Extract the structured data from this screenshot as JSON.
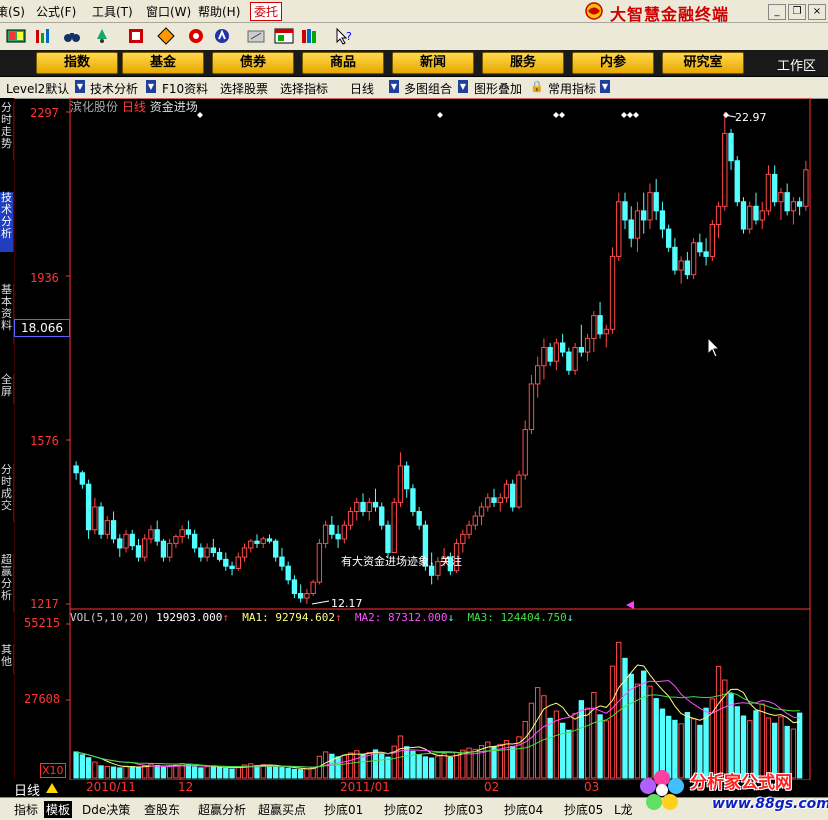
{
  "menu": {
    "items": [
      "策(S)",
      "公式(F)",
      "工具(T)",
      "窗口(W)",
      "帮助(H)"
    ],
    "weituo": "委托",
    "brand": "大智慧金融终端"
  },
  "toolbar": {
    "icons": [
      "grid-icon",
      "bars-icon",
      "binoculars-icon",
      "alarm-icon",
      "bookmark-icon",
      "diamond-icon",
      "radar-icon",
      "hand-icon",
      "pen-icon",
      "window-icon",
      "books-icon",
      "help-pointer-icon"
    ]
  },
  "nav": {
    "buttons": [
      "指数",
      "基金",
      "债券",
      "商品",
      "新闻",
      "服务",
      "内参",
      "研究室"
    ],
    "workspace": "工作区"
  },
  "funcbar": {
    "items": [
      "Level2默认",
      "技术分析",
      "F10资料",
      "选择股票",
      "选择指标",
      "日线",
      "多图组合",
      "图形叠加",
      "常用指标"
    ]
  },
  "lefttabs": [
    "分时走势",
    "技术分析",
    "基本资料",
    "全屏",
    "分时成交",
    "超赢分析",
    "其他"
  ],
  "chart": {
    "stock_name": "滨化股份",
    "period": "日线",
    "indicator": "资金进场",
    "current_price": "18.066",
    "annotation": "有大资金进场迹象，关注",
    "low_label": "12.17",
    "high_label": "22.97",
    "x10": "X10",
    "period_label": "日线"
  },
  "volume": {
    "label": "VOL(5,10,20)",
    "value": "192903.000",
    "ma1_label": "MA1:",
    "ma1": "92794.602",
    "ma2_label": "MA2:",
    "ma2": "87312.000",
    "ma3_label": "MA3:",
    "ma3": "124404.750"
  },
  "colors": {
    "up": "#ff4a4a",
    "down": "#54ffff",
    "ma1": "#ffff80",
    "ma2": "#ff50ff",
    "ma3": "#40e040",
    "axis": "#ff3333"
  },
  "chart_data": {
    "type": "candlestick",
    "price_axis": {
      "ticks": [
        "2297",
        "1936",
        "1576",
        "1217"
      ],
      "ylim": [
        12.17,
        22.97
      ]
    },
    "volume_axis": {
      "ticks": [
        "55215",
        "27608"
      ],
      "ylim": [
        0,
        55215
      ]
    },
    "x_ticks": [
      "2010/11",
      "12",
      "2011/01",
      "02",
      "03"
    ],
    "candles": [
      [
        15.2,
        15.3,
        14.9,
        15.05
      ],
      [
        15.05,
        15.1,
        14.7,
        14.8
      ],
      [
        14.8,
        14.9,
        13.6,
        13.8
      ],
      [
        13.8,
        14.5,
        13.7,
        14.3
      ],
      [
        14.3,
        14.4,
        13.6,
        13.7
      ],
      [
        13.7,
        14.1,
        13.6,
        14.0
      ],
      [
        14.0,
        14.2,
        13.5,
        13.6
      ],
      [
        13.6,
        13.7,
        13.2,
        13.4
      ],
      [
        13.4,
        13.8,
        13.3,
        13.7
      ],
      [
        13.7,
        13.8,
        13.35,
        13.45
      ],
      [
        13.45,
        13.6,
        13.1,
        13.2
      ],
      [
        13.2,
        13.7,
        13.1,
        13.6
      ],
      [
        13.6,
        13.9,
        13.5,
        13.8
      ],
      [
        13.8,
        14.0,
        13.45,
        13.55
      ],
      [
        13.55,
        13.6,
        13.1,
        13.2
      ],
      [
        13.2,
        13.6,
        13.1,
        13.5
      ],
      [
        13.5,
        13.7,
        13.4,
        13.65
      ],
      [
        13.65,
        13.9,
        13.5,
        13.8
      ],
      [
        13.8,
        14.0,
        13.6,
        13.7
      ],
      [
        13.7,
        13.8,
        13.3,
        13.4
      ],
      [
        13.4,
        13.5,
        13.1,
        13.2
      ],
      [
        13.2,
        13.5,
        13.1,
        13.4
      ],
      [
        13.4,
        13.6,
        13.2,
        13.3
      ],
      [
        13.3,
        13.4,
        13.1,
        13.15
      ],
      [
        13.15,
        13.3,
        12.9,
        13.0
      ],
      [
        13.0,
        13.1,
        12.8,
        12.95
      ],
      [
        12.95,
        13.3,
        12.9,
        13.2
      ],
      [
        13.2,
        13.5,
        13.1,
        13.4
      ],
      [
        13.4,
        13.6,
        13.3,
        13.55
      ],
      [
        13.55,
        13.7,
        13.4,
        13.5
      ],
      [
        13.5,
        13.65,
        13.4,
        13.6
      ],
      [
        13.6,
        13.7,
        13.5,
        13.55
      ],
      [
        13.55,
        13.6,
        13.1,
        13.2
      ],
      [
        13.2,
        13.4,
        12.9,
        13.0
      ],
      [
        13.0,
        13.1,
        12.6,
        12.7
      ],
      [
        12.7,
        12.8,
        12.3,
        12.4
      ],
      [
        12.4,
        12.6,
        12.2,
        12.3
      ],
      [
        12.3,
        12.5,
        12.17,
        12.4
      ],
      [
        12.4,
        12.7,
        12.35,
        12.65
      ],
      [
        12.65,
        13.6,
        12.6,
        13.5
      ],
      [
        13.5,
        14.0,
        13.4,
        13.9
      ],
      [
        13.9,
        14.1,
        13.6,
        13.7
      ],
      [
        13.7,
        13.9,
        13.4,
        13.6
      ],
      [
        13.6,
        14.0,
        13.5,
        13.9
      ],
      [
        13.9,
        14.3,
        13.8,
        14.2
      ],
      [
        14.2,
        14.5,
        14.0,
        14.4
      ],
      [
        14.4,
        14.6,
        14.1,
        14.2
      ],
      [
        14.2,
        14.5,
        14.0,
        14.4
      ],
      [
        14.4,
        14.7,
        14.2,
        14.3
      ],
      [
        14.3,
        14.4,
        13.8,
        13.9
      ],
      [
        13.9,
        14.0,
        13.2,
        13.3
      ],
      [
        13.3,
        14.5,
        13.3,
        14.4
      ],
      [
        14.4,
        15.5,
        14.3,
        15.2
      ],
      [
        15.2,
        15.3,
        14.5,
        14.7
      ],
      [
        14.7,
        14.8,
        14.1,
        14.2
      ],
      [
        14.2,
        14.3,
        13.8,
        13.9
      ],
      [
        13.9,
        14.0,
        12.9,
        13.0
      ],
      [
        13.0,
        13.3,
        12.6,
        12.8
      ],
      [
        12.8,
        13.2,
        12.7,
        13.1
      ],
      [
        13.1,
        13.4,
        13.0,
        13.2
      ],
      [
        13.2,
        13.3,
        12.8,
        12.9
      ],
      [
        12.9,
        13.6,
        12.85,
        13.5
      ],
      [
        13.5,
        13.8,
        13.3,
        13.7
      ],
      [
        13.7,
        14.0,
        13.6,
        13.9
      ],
      [
        13.9,
        14.2,
        13.8,
        14.1
      ],
      [
        14.1,
        14.4,
        13.9,
        14.3
      ],
      [
        14.3,
        14.6,
        14.2,
        14.5
      ],
      [
        14.5,
        14.7,
        14.3,
        14.4
      ],
      [
        14.4,
        14.6,
        14.2,
        14.5
      ],
      [
        14.5,
        14.9,
        14.4,
        14.8
      ],
      [
        14.8,
        14.9,
        14.2,
        14.3
      ],
      [
        14.3,
        15.1,
        14.25,
        15.0
      ],
      [
        15.0,
        16.2,
        14.9,
        16.0
      ],
      [
        16.0,
        17.2,
        15.9,
        17.0
      ],
      [
        17.0,
        17.6,
        16.7,
        17.4
      ],
      [
        17.4,
        18.0,
        17.1,
        17.8
      ],
      [
        17.8,
        17.9,
        17.4,
        17.5
      ],
      [
        17.5,
        18.0,
        17.3,
        17.9
      ],
      [
        17.9,
        18.1,
        17.6,
        17.7
      ],
      [
        17.7,
        17.8,
        17.2,
        17.3
      ],
      [
        17.3,
        17.9,
        17.2,
        17.8
      ],
      [
        17.8,
        18.3,
        17.6,
        17.7
      ],
      [
        17.7,
        18.1,
        17.5,
        18.0
      ],
      [
        18.0,
        18.6,
        17.7,
        18.5
      ],
      [
        18.5,
        18.8,
        18.0,
        18.1
      ],
      [
        18.1,
        18.3,
        17.8,
        18.2
      ],
      [
        18.2,
        20.0,
        18.1,
        19.8
      ],
      [
        19.8,
        21.2,
        19.7,
        21.0
      ],
      [
        21.0,
        21.2,
        20.4,
        20.6
      ],
      [
        20.6,
        20.9,
        20.0,
        20.2
      ],
      [
        20.2,
        21.0,
        19.9,
        20.8
      ],
      [
        20.8,
        21.2,
        20.3,
        20.6
      ],
      [
        20.6,
        21.4,
        20.4,
        21.2
      ],
      [
        21.2,
        21.5,
        20.6,
        20.8
      ],
      [
        20.8,
        21.0,
        20.2,
        20.4
      ],
      [
        20.4,
        20.5,
        19.9,
        20.0
      ],
      [
        20.0,
        20.2,
        19.4,
        19.5
      ],
      [
        19.5,
        19.8,
        19.2,
        19.7
      ],
      [
        19.7,
        19.9,
        19.3,
        19.4
      ],
      [
        19.4,
        20.2,
        19.3,
        20.1
      ],
      [
        20.1,
        20.3,
        19.8,
        19.9
      ],
      [
        19.9,
        20.2,
        19.6,
        19.8
      ],
      [
        19.8,
        20.6,
        19.7,
        20.5
      ],
      [
        20.5,
        21.0,
        20.2,
        20.9
      ],
      [
        20.9,
        22.97,
        20.8,
        22.5
      ],
      [
        22.5,
        22.6,
        21.7,
        21.9
      ],
      [
        21.9,
        22.0,
        20.9,
        21.0
      ],
      [
        21.0,
        21.1,
        20.3,
        20.4
      ],
      [
        20.4,
        21.0,
        20.3,
        20.9
      ],
      [
        20.9,
        21.2,
        20.5,
        20.6
      ],
      [
        20.6,
        21.0,
        20.4,
        20.8
      ],
      [
        20.8,
        21.8,
        20.7,
        21.6
      ],
      [
        21.6,
        21.8,
        20.9,
        21.0
      ],
      [
        21.0,
        21.3,
        20.6,
        21.2
      ],
      [
        21.2,
        21.4,
        20.7,
        20.8
      ],
      [
        20.8,
        21.1,
        20.5,
        21.0
      ],
      [
        21.0,
        21.1,
        20.7,
        20.9
      ],
      [
        20.9,
        21.9,
        20.8,
        21.7
      ]
    ],
    "volumes": [
      9000,
      8000,
      7000,
      5500,
      4200,
      4000,
      3800,
      3500,
      4100,
      3900,
      3600,
      4200,
      4800,
      4300,
      3700,
      3900,
      4400,
      5000,
      4600,
      3800,
      3500,
      3900,
      4200,
      3600,
      3300,
      3100,
      3800,
      4500,
      4900,
      4300,
      4600,
      4200,
      3900,
      3600,
      3400,
      3000,
      2900,
      3100,
      3500,
      7500,
      9000,
      8200,
      7300,
      7800,
      8600,
      9400,
      8100,
      8800,
      9700,
      8300,
      7200,
      11000,
      14500,
      10800,
      9200,
      8100,
      7300,
      6900,
      7600,
      8400,
      7100,
      8800,
      9600,
      10300,
      9900,
      11200,
      12400,
      10800,
      11600,
      12900,
      10900,
      14200,
      19500,
      25800,
      31200,
      28400,
      20600,
      23100,
      18900,
      16500,
      22300,
      26700,
      24100,
      29500,
      21800,
      19700,
      38600,
      46800,
      41300,
      35800,
      32400,
      36900,
      31700,
      27400,
      23800,
      21300,
      19900,
      18700,
      22600,
      20400,
      18200,
      24100,
      27300,
      38500,
      33800,
      29100,
      24600,
      21400,
      19800,
      23200,
      25500,
      20700,
      18900,
      21100,
      17800,
      16900,
      22400
    ]
  }
}
